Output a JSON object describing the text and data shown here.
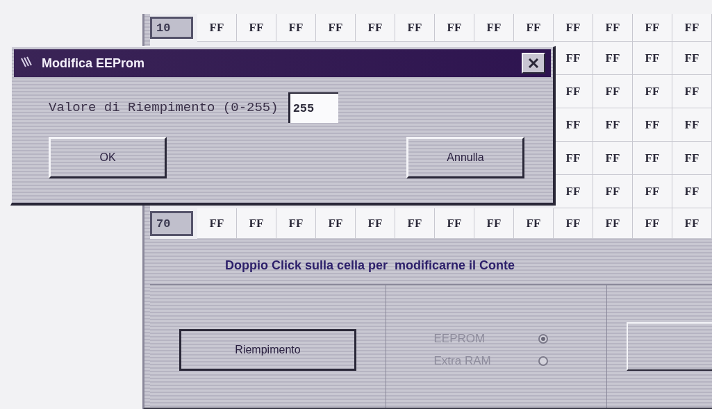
{
  "dialog": {
    "title": "Modifica EEProm",
    "label": "Valore di Riempimento (0-255)",
    "value": "255",
    "buttons": [
      "OK",
      "Annulla"
    ]
  },
  "grid": {
    "rows": [
      {
        "label": "10",
        "cells": [
          "FF",
          "FF",
          "FF",
          "FF",
          "FF",
          "FF",
          "FF",
          "FF",
          "FF",
          "FF",
          "FF",
          "FF",
          "FF"
        ]
      },
      {
        "cells": [
          "FF",
          "FF",
          "FF",
          "FF"
        ]
      },
      {
        "cells": [
          "FF",
          "FF",
          "FF",
          "FF"
        ]
      },
      {
        "cells": [
          "FF",
          "FF",
          "FF",
          "FF"
        ]
      },
      {
        "cells": [
          "FF",
          "FF",
          "FF",
          "FF"
        ]
      },
      {
        "cells": [
          "FF",
          "FF",
          "FF",
          "FF"
        ]
      },
      {
        "label": "70",
        "cells": [
          "FF",
          "FF",
          "FF",
          "FF",
          "FF",
          "FF",
          "FF",
          "FF",
          "FF",
          "FF",
          "FF",
          "FF",
          "FF"
        ]
      }
    ]
  },
  "message": "Doppio Click sulla cella per  modificarne il Conte",
  "fill_button": "Riempimento",
  "memory_options": [
    {
      "label": "EEPROM",
      "selected": true,
      "disabled": true
    },
    {
      "label": "Extra RAM",
      "selected": false,
      "disabled": true
    }
  ]
}
